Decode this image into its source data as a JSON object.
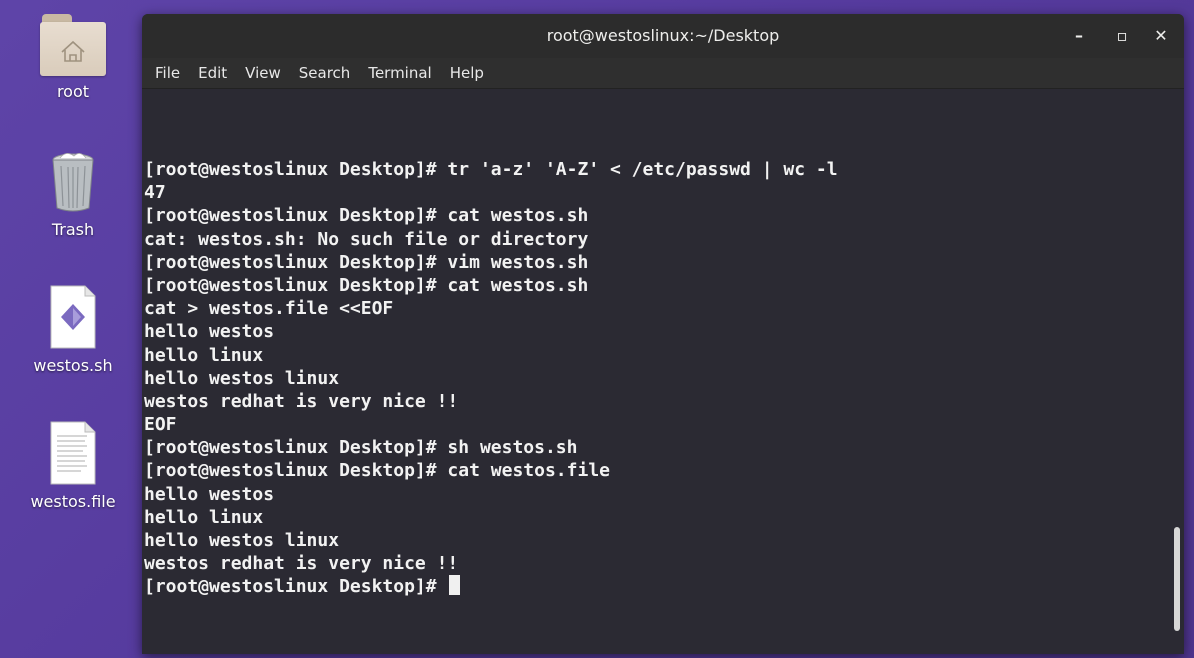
{
  "desktop": {
    "icons": [
      {
        "label": "root",
        "icon": "home-folder-icon"
      },
      {
        "label": "Trash",
        "icon": "trash-icon"
      },
      {
        "label": "westos.sh",
        "icon": "script-file-icon"
      },
      {
        "label": "westos.file",
        "icon": "text-file-icon"
      }
    ]
  },
  "window": {
    "title": "root@westoslinux:~/Desktop",
    "minimize_label": "–",
    "maximize_label": "▫",
    "close_label": "✕"
  },
  "menu": {
    "items": [
      "File",
      "Edit",
      "View",
      "Search",
      "Terminal",
      "Help"
    ]
  },
  "terminal": {
    "lines": [
      "[root@westoslinux Desktop]# tr 'a-z' 'A-Z' < /etc/passwd | wc -l",
      "47",
      "[root@westoslinux Desktop]# cat westos.sh",
      "cat: westos.sh: No such file or directory",
      "[root@westoslinux Desktop]# vim westos.sh",
      "[root@westoslinux Desktop]# cat westos.sh",
      "cat > westos.file <<EOF",
      "hello westos",
      "hello linux",
      "hello westos linux",
      "westos redhat is very nice !!",
      "EOF",
      "[root@westoslinux Desktop]# sh westos.sh",
      "[root@westoslinux Desktop]# cat westos.file",
      "hello westos",
      "hello linux",
      "hello westos linux",
      "westos redhat is very nice !!",
      "[root@westoslinux Desktop]# "
    ]
  },
  "colors": {
    "desktop_bg": "#5a3fa2",
    "terminal_bg": "#2b2a33",
    "titlebar_bg": "#2c2c2c",
    "text": "#f2f2f2"
  }
}
